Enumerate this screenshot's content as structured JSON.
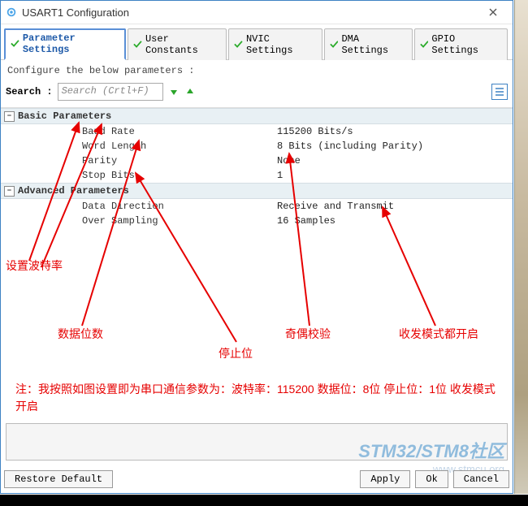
{
  "window": {
    "title": "USART1 Configuration"
  },
  "tabs": [
    {
      "label": "Parameter Settings",
      "active": true
    },
    {
      "label": "User Constants",
      "active": false
    },
    {
      "label": "NVIC Settings",
      "active": false
    },
    {
      "label": "DMA Settings",
      "active": false
    },
    {
      "label": "GPIO Settings",
      "active": false
    }
  ],
  "subtitle": "Configure the below parameters :",
  "search": {
    "label": "Search :",
    "placeholder": "Search (Crtl+F)"
  },
  "groups": {
    "basic": {
      "title": "Basic Parameters",
      "params": [
        {
          "name": "Baud Rate",
          "value": "115200 Bits/s"
        },
        {
          "name": "Word Length",
          "value": "8 Bits (including Parity)"
        },
        {
          "name": "Parity",
          "value": "None"
        },
        {
          "name": "Stop Bits",
          "value": "1"
        }
      ]
    },
    "advanced": {
      "title": "Advanced Parameters",
      "params": [
        {
          "name": "Data Direction",
          "value": "Receive and Transmit"
        },
        {
          "name": "Over Sampling",
          "value": "16 Samples"
        }
      ]
    }
  },
  "annotations": {
    "baud": "设置波特率",
    "databits": "数据位数",
    "stopbits": "停止位",
    "parity": "奇偶校验",
    "mode": "收发模式都开启",
    "note": "注：我按照如图设置即为串口通信参数为：波特率：115200 数据位：8位 停止位：1位 收发模式开启"
  },
  "footer": {
    "restore": "Restore Default",
    "apply": "Apply",
    "ok": "Ok",
    "cancel": "Cancel"
  },
  "watermark": {
    "main": "STM32/STM8社区",
    "sub": "www.stmcu.org"
  }
}
